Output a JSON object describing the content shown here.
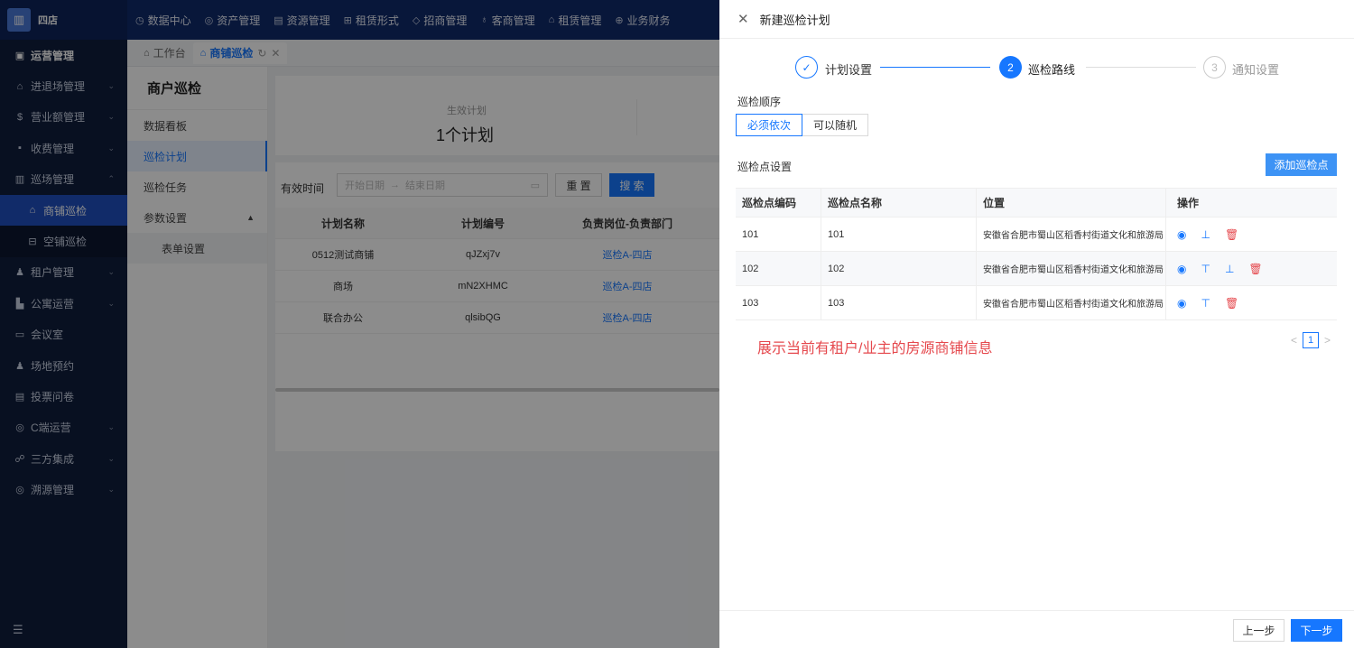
{
  "brand": {
    "name": "四店",
    "logo_icon": "building-icon"
  },
  "topnav": [
    {
      "label": "数据中心",
      "icon": "◷"
    },
    {
      "label": "资产管理",
      "icon": "◎"
    },
    {
      "label": "资源管理",
      "icon": "▤"
    },
    {
      "label": "租赁形式",
      "icon": "⊞"
    },
    {
      "label": "招商管理",
      "icon": "◇"
    },
    {
      "label": "客商管理",
      "icon": "♁"
    },
    {
      "label": "租赁管理",
      "icon": "⌂"
    },
    {
      "label": "业务财务",
      "icon": "⊕"
    }
  ],
  "sidebar": {
    "items": [
      {
        "label": "运营管理",
        "icon": "▣"
      },
      {
        "label": "进退场管理",
        "icon": "⌂",
        "arrow": "⌄"
      },
      {
        "label": "营业额管理",
        "icon": "$",
        "arrow": "⌄"
      },
      {
        "label": "收费管理",
        "icon": "▪",
        "arrow": "⌄"
      },
      {
        "label": "巡场管理",
        "icon": "▥",
        "arrow": "⌃"
      },
      {
        "label": "商铺巡检",
        "icon": "⌂"
      },
      {
        "label": "空铺巡检",
        "icon": "⊟"
      },
      {
        "label": "租户管理",
        "icon": "♟",
        "arrow": "⌄"
      },
      {
        "label": "公寓运营",
        "icon": "▙",
        "arrow": "⌄"
      },
      {
        "label": "会议室",
        "icon": "▭"
      },
      {
        "label": "场地预约",
        "icon": "♟"
      },
      {
        "label": "投票问卷",
        "icon": "▤"
      },
      {
        "label": "C端运营",
        "icon": "◎",
        "arrow": "⌄"
      },
      {
        "label": "三方集成",
        "icon": "☍",
        "arrow": "⌄"
      },
      {
        "label": "溯源管理",
        "icon": "◎",
        "arrow": "⌄"
      }
    ],
    "bottom_icon": "☰"
  },
  "tabs": [
    {
      "label": "工作台",
      "icon": "⌂"
    },
    {
      "label": "商铺巡检",
      "icon": "⌂",
      "refresh": "↻",
      "close": "✕"
    }
  ],
  "submenu": {
    "title": "商户巡检",
    "items": [
      {
        "label": "数据看板"
      },
      {
        "label": "巡检计划"
      },
      {
        "label": "巡检任务"
      },
      {
        "label": "参数设置",
        "caret": "▲"
      },
      {
        "label": "表单设置"
      }
    ]
  },
  "main": {
    "stat_label": "生效计划",
    "stat_value": "1个计划",
    "filter_label": "有效时间",
    "date_start_placeholder": "开始日期",
    "date_arrow": "→",
    "date_end_placeholder": "结束日期",
    "reset_label": "重 置",
    "search_label": "搜 索",
    "table_headers": [
      "计划名称",
      "计划编号",
      "负责岗位-负责部门"
    ],
    "rows": [
      {
        "name": "0512测试商铺",
        "code": "qJZxj7v",
        "post": "巡检A-四店"
      },
      {
        "name": "商场",
        "code": "mN2XHMC",
        "post": "巡检A-四店"
      },
      {
        "name": "联合办公",
        "code": "qlsibQG",
        "post": "巡检A-四店"
      }
    ]
  },
  "drawer": {
    "title": "新建巡检计划",
    "steps": [
      {
        "index": "✓",
        "label": "计划设置"
      },
      {
        "index": "2",
        "label": "巡检路线"
      },
      {
        "index": "3",
        "label": "通知设置"
      }
    ],
    "order_label": "巡检顺序",
    "order_options": [
      "必须依次",
      "可以随机"
    ],
    "points_label": "巡检点设置",
    "add_point_label": "添加巡检点",
    "table_headers": [
      "巡检点编码",
      "巡检点名称",
      "位置",
      "操作"
    ],
    "points": [
      {
        "code": "101",
        "name": "101",
        "location": "安徽省合肥市蜀山区稻香村街道文化和旅游局"
      },
      {
        "code": "102",
        "name": "102",
        "location": "安徽省合肥市蜀山区稻香村街道文化和旅游局"
      },
      {
        "code": "103",
        "name": "103",
        "location": "安徽省合肥市蜀山区稻香村街道文化和旅游局"
      }
    ],
    "note": "展示当前有租户/业主的房源商铺信息",
    "pager": {
      "prev": "<",
      "page": "1",
      "next": ">"
    },
    "prev_label": "上一步",
    "next_label": "下一步"
  }
}
